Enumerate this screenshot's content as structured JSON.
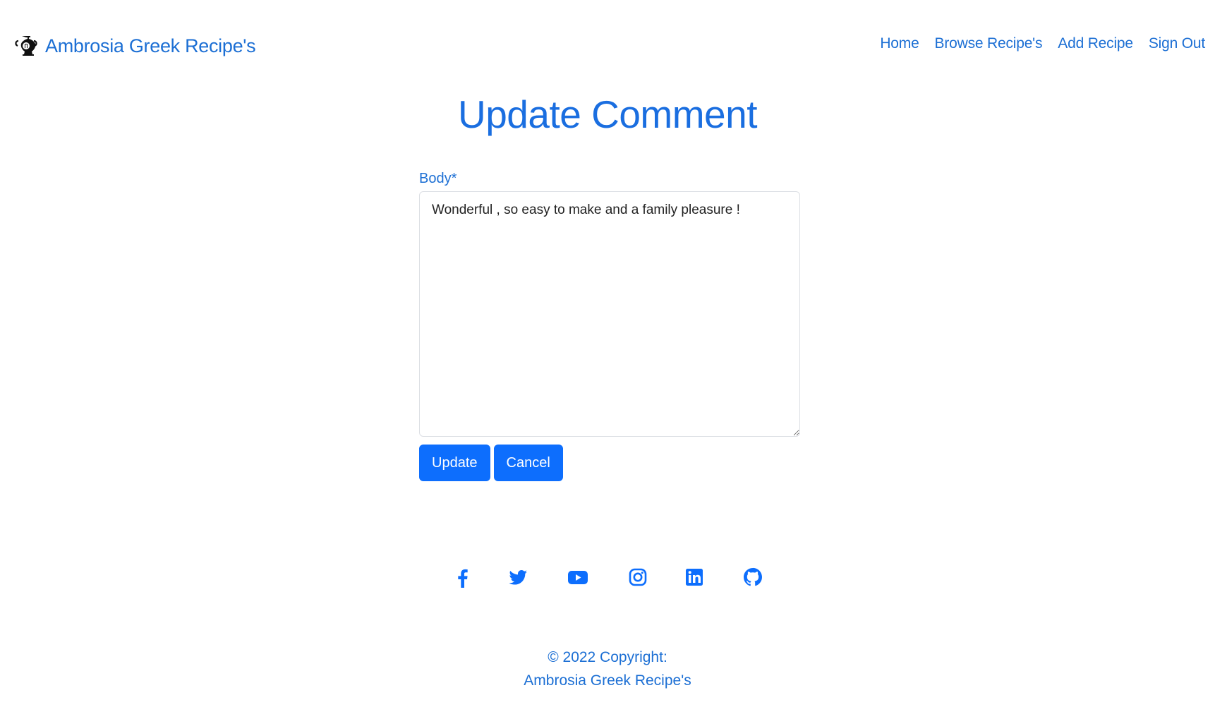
{
  "brand": {
    "name": "Ambrosia Greek Recipe's",
    "logo_icon": "greek-amphora-icon"
  },
  "nav": {
    "items": [
      {
        "label": "Home"
      },
      {
        "label": "Browse Recipe's"
      },
      {
        "label": "Add Recipe"
      },
      {
        "label": "Sign Out"
      }
    ]
  },
  "page": {
    "title": "Update Comment"
  },
  "form": {
    "body_label": "Body*",
    "body_value": "Wonderful , so easy to make and a family pleasure !",
    "update_label": "Update",
    "cancel_label": "Cancel"
  },
  "social": {
    "icons": [
      "facebook-icon",
      "twitter-icon",
      "youtube-icon",
      "instagram-icon",
      "linkedin-icon",
      "github-icon"
    ]
  },
  "footer": {
    "copyright": "© 2022 Copyright:",
    "site_name": "Ambrosia Greek Recipe's"
  },
  "colors": {
    "accent": "#0d6efd",
    "link": "#1c6fd4"
  }
}
